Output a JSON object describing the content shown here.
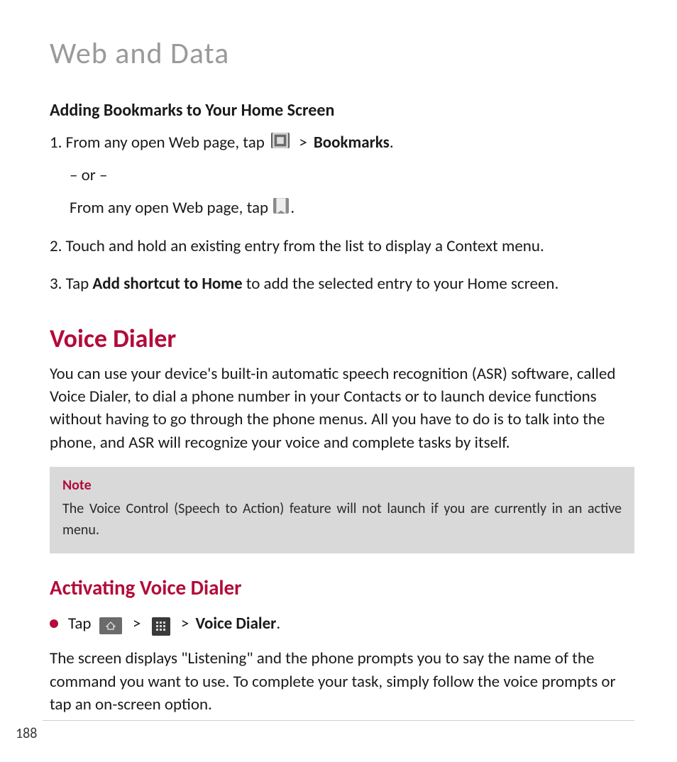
{
  "chapter_title": "Web and Data",
  "section1": {
    "title": "Adding Bookmarks to Your Home Screen",
    "step1_pre": "1. From any open Web page, tap ",
    "step1_gt": ">",
    "step1_bold": "Bookmarks",
    "step1_post": ".",
    "or": "– or –",
    "alt_pre": "From any open Web page, tap ",
    "alt_post": ".",
    "step2": "2. Touch and hold an existing entry from the list to display a Context menu.",
    "step3_pre": "3. Tap ",
    "step3_bold": "Add shortcut to Home",
    "step3_post": " to add the selected entry to your Home screen."
  },
  "voice": {
    "heading": "Voice Dialer",
    "intro": "You can use your device's built-in automatic speech recognition (ASR) software, called Voice Dialer, to dial a phone number in your Contacts or to launch device functions without having to go through the phone menus. All you have to do is to talk into the phone, and ASR will recognize your voice and complete tasks by itself.",
    "note_label": "Note",
    "note_text": "The Voice Control (Speech to Action) feature will not launch if you are currently in an active menu."
  },
  "activating": {
    "heading": "Activating Voice Dialer",
    "bullet_pre": "Tap ",
    "gt1": ">",
    "gt2": ">",
    "bullet_bold": "Voice Dialer",
    "bullet_post": ".",
    "para": "The screen displays \"Listening\" and the phone prompts you to say the name of the command you want to use. To complete your task, simply follow the voice prompts or tap an on-screen option."
  },
  "page_number": "188"
}
